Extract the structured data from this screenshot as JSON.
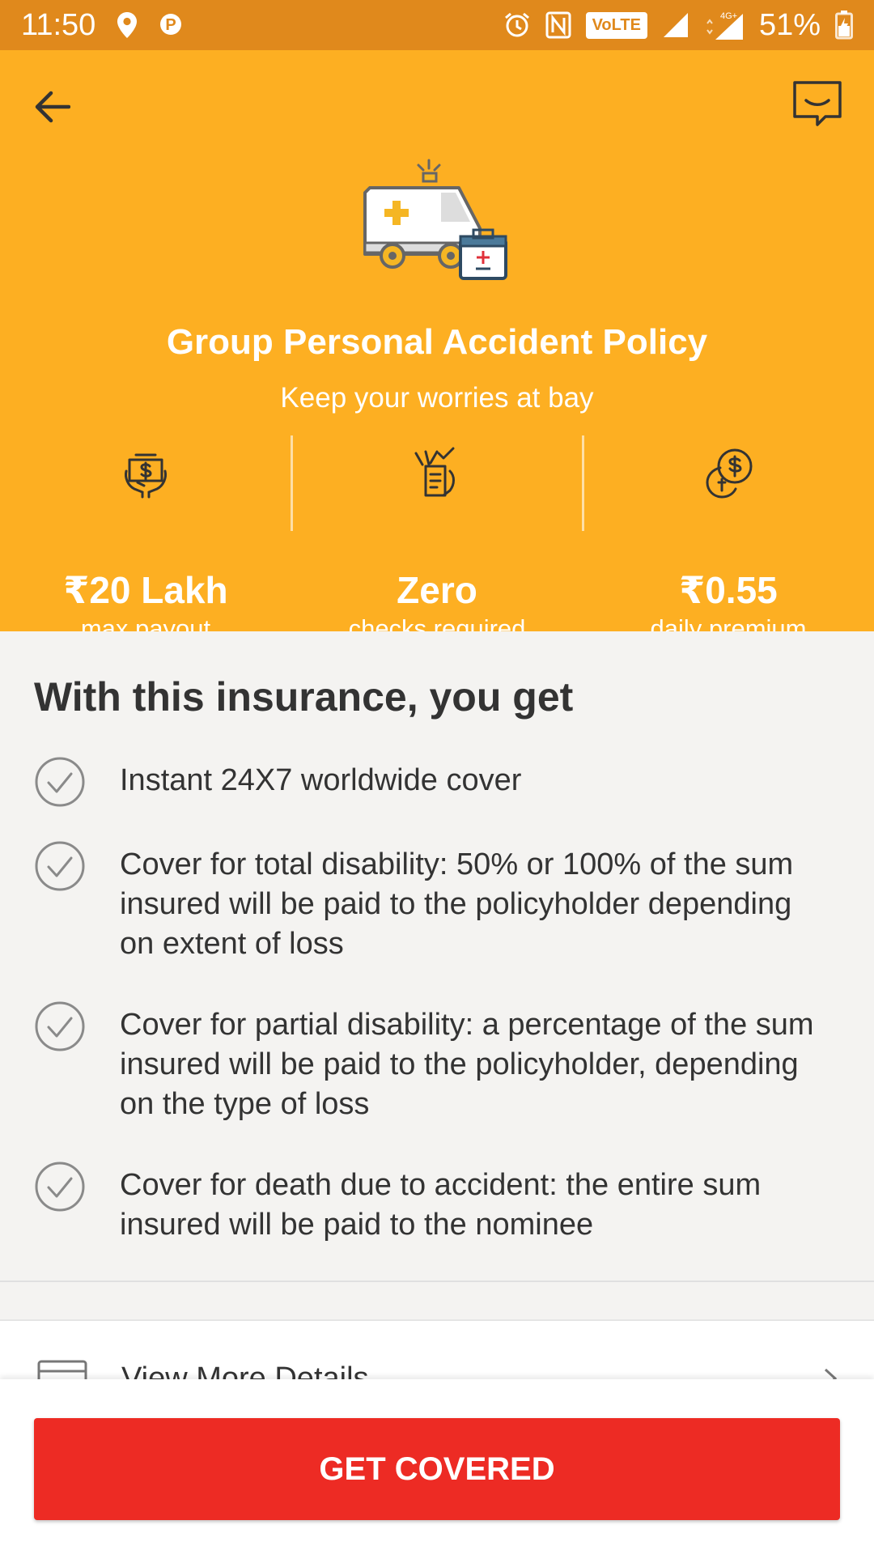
{
  "status_bar": {
    "time": "11:50",
    "volte": "VoLTE",
    "network": "4G+",
    "battery": "51%"
  },
  "header": {
    "title": "Group Personal Accident Policy",
    "subtitle": "Keep your worries at bay",
    "stats": [
      {
        "value": "₹20 Lakh",
        "label": "max payout",
        "icon": "payout-icon"
      },
      {
        "value": "Zero",
        "label": "checks required",
        "icon": "checks-icon"
      },
      {
        "value": "₹0.55",
        "label": "daily premium",
        "icon": "coins-icon"
      }
    ]
  },
  "benefits": {
    "heading": "With this insurance, you get",
    "items": [
      "Instant 24X7 worldwide cover",
      "Cover for total disability: 50% or 100% of the sum insured will be paid to the policyholder depending on extent of loss",
      "Cover for partial disability: a percentage of the sum insured will be paid to the policyholder, depending on the type of loss",
      "Cover for death due to accident: the entire sum insured will be paid to the nominee"
    ]
  },
  "view_more": {
    "label": "View More Details"
  },
  "cta": {
    "label": "GET COVERED"
  },
  "colors": {
    "status_bar": "#e0891c",
    "header": "#fdaf22",
    "cta": "#ed2b24"
  }
}
